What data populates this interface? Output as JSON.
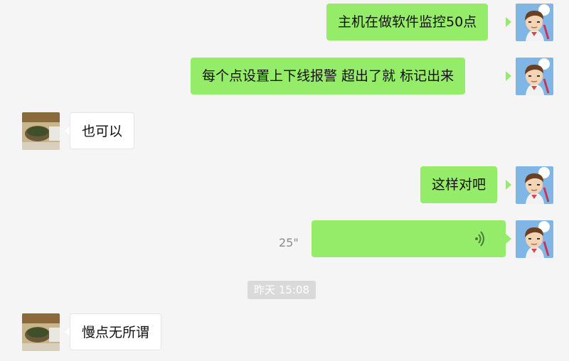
{
  "messages": [
    {
      "side": "out",
      "text": "主机在做软件监控50点"
    },
    {
      "side": "out",
      "text": "每个点设置上下线报警  超出了就 标记出来"
    },
    {
      "side": "in",
      "text": "也可以"
    },
    {
      "side": "out",
      "text": "这样对吧"
    },
    {
      "side": "out",
      "type": "voice",
      "duration": "25\""
    },
    {
      "type": "timestamp",
      "text": "昨天 15:08"
    },
    {
      "side": "in",
      "text": "慢点无所谓"
    }
  ],
  "colors": {
    "background": "#f5f5f5",
    "outgoing_bubble": "#95ec69",
    "incoming_bubble": "#ffffff",
    "timestamp_bg": "#dadada"
  }
}
